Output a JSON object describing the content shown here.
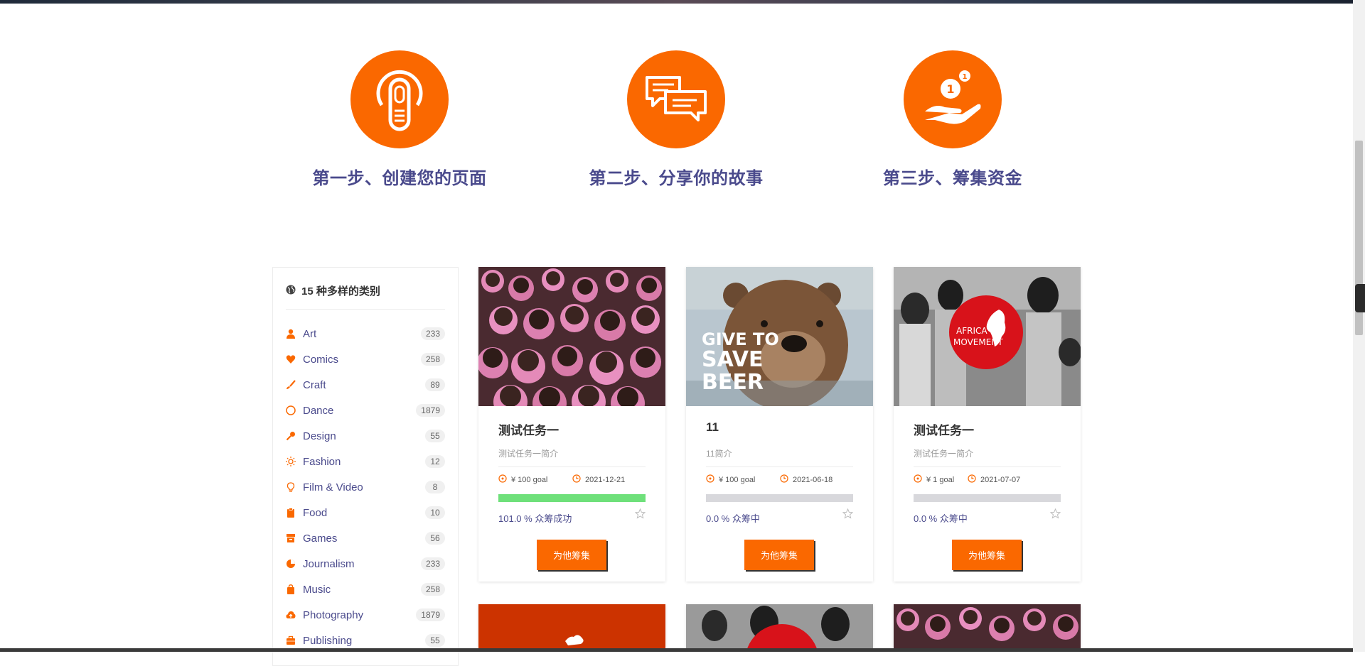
{
  "steps": [
    {
      "title": "第一步、创建您的页面",
      "icon": "touch-icon"
    },
    {
      "title": "第二步、分享你的故事",
      "icon": "chat-icon"
    },
    {
      "title": "第三步、筹集资金",
      "icon": "coin-hand-icon"
    }
  ],
  "sidebar": {
    "title": "15 种多样的类别",
    "categories": [
      {
        "label": "Art",
        "count": "233"
      },
      {
        "label": "Comics",
        "count": "258"
      },
      {
        "label": "Craft",
        "count": "89"
      },
      {
        "label": "Dance",
        "count": "1879"
      },
      {
        "label": "Design",
        "count": "55"
      },
      {
        "label": "Fashion",
        "count": "12"
      },
      {
        "label": "Film & Video",
        "count": "8"
      },
      {
        "label": "Food",
        "count": "10"
      },
      {
        "label": "Games",
        "count": "56"
      },
      {
        "label": "Journalism",
        "count": "233"
      },
      {
        "label": "Music",
        "count": "258"
      },
      {
        "label": "Photography",
        "count": "1879"
      },
      {
        "label": "Publishing",
        "count": "55"
      }
    ]
  },
  "cards": [
    {
      "name": "测试任务一",
      "desc": "测试任务一简介",
      "goal": "¥ 100 goal",
      "date": "2021-12-21",
      "percent": "101.0 %",
      "state": "众筹成功",
      "progress": 1.0,
      "button": "为他筹集",
      "image_text": ""
    },
    {
      "name": "11",
      "desc": "11简介",
      "goal": "¥ 100 goal",
      "date": "2021-06-18",
      "percent": "0.0 %",
      "state": "众筹中",
      "progress": 0.0,
      "button": "为他筹集",
      "image_text": "GIVE TO SAVE BEER"
    },
    {
      "name": "测试任务一",
      "desc": "测试任务一简介",
      "goal": "¥ 1 goal",
      "date": "2021-07-07",
      "percent": "0.0 %",
      "state": "众筹中",
      "progress": 0.0,
      "button": "为他筹集",
      "image_text": "AFRICA MOVEMENT"
    }
  ],
  "colors": {
    "accent": "#fa6800",
    "heading": "#4a4a8c",
    "progress_done": "#6ee07a"
  }
}
